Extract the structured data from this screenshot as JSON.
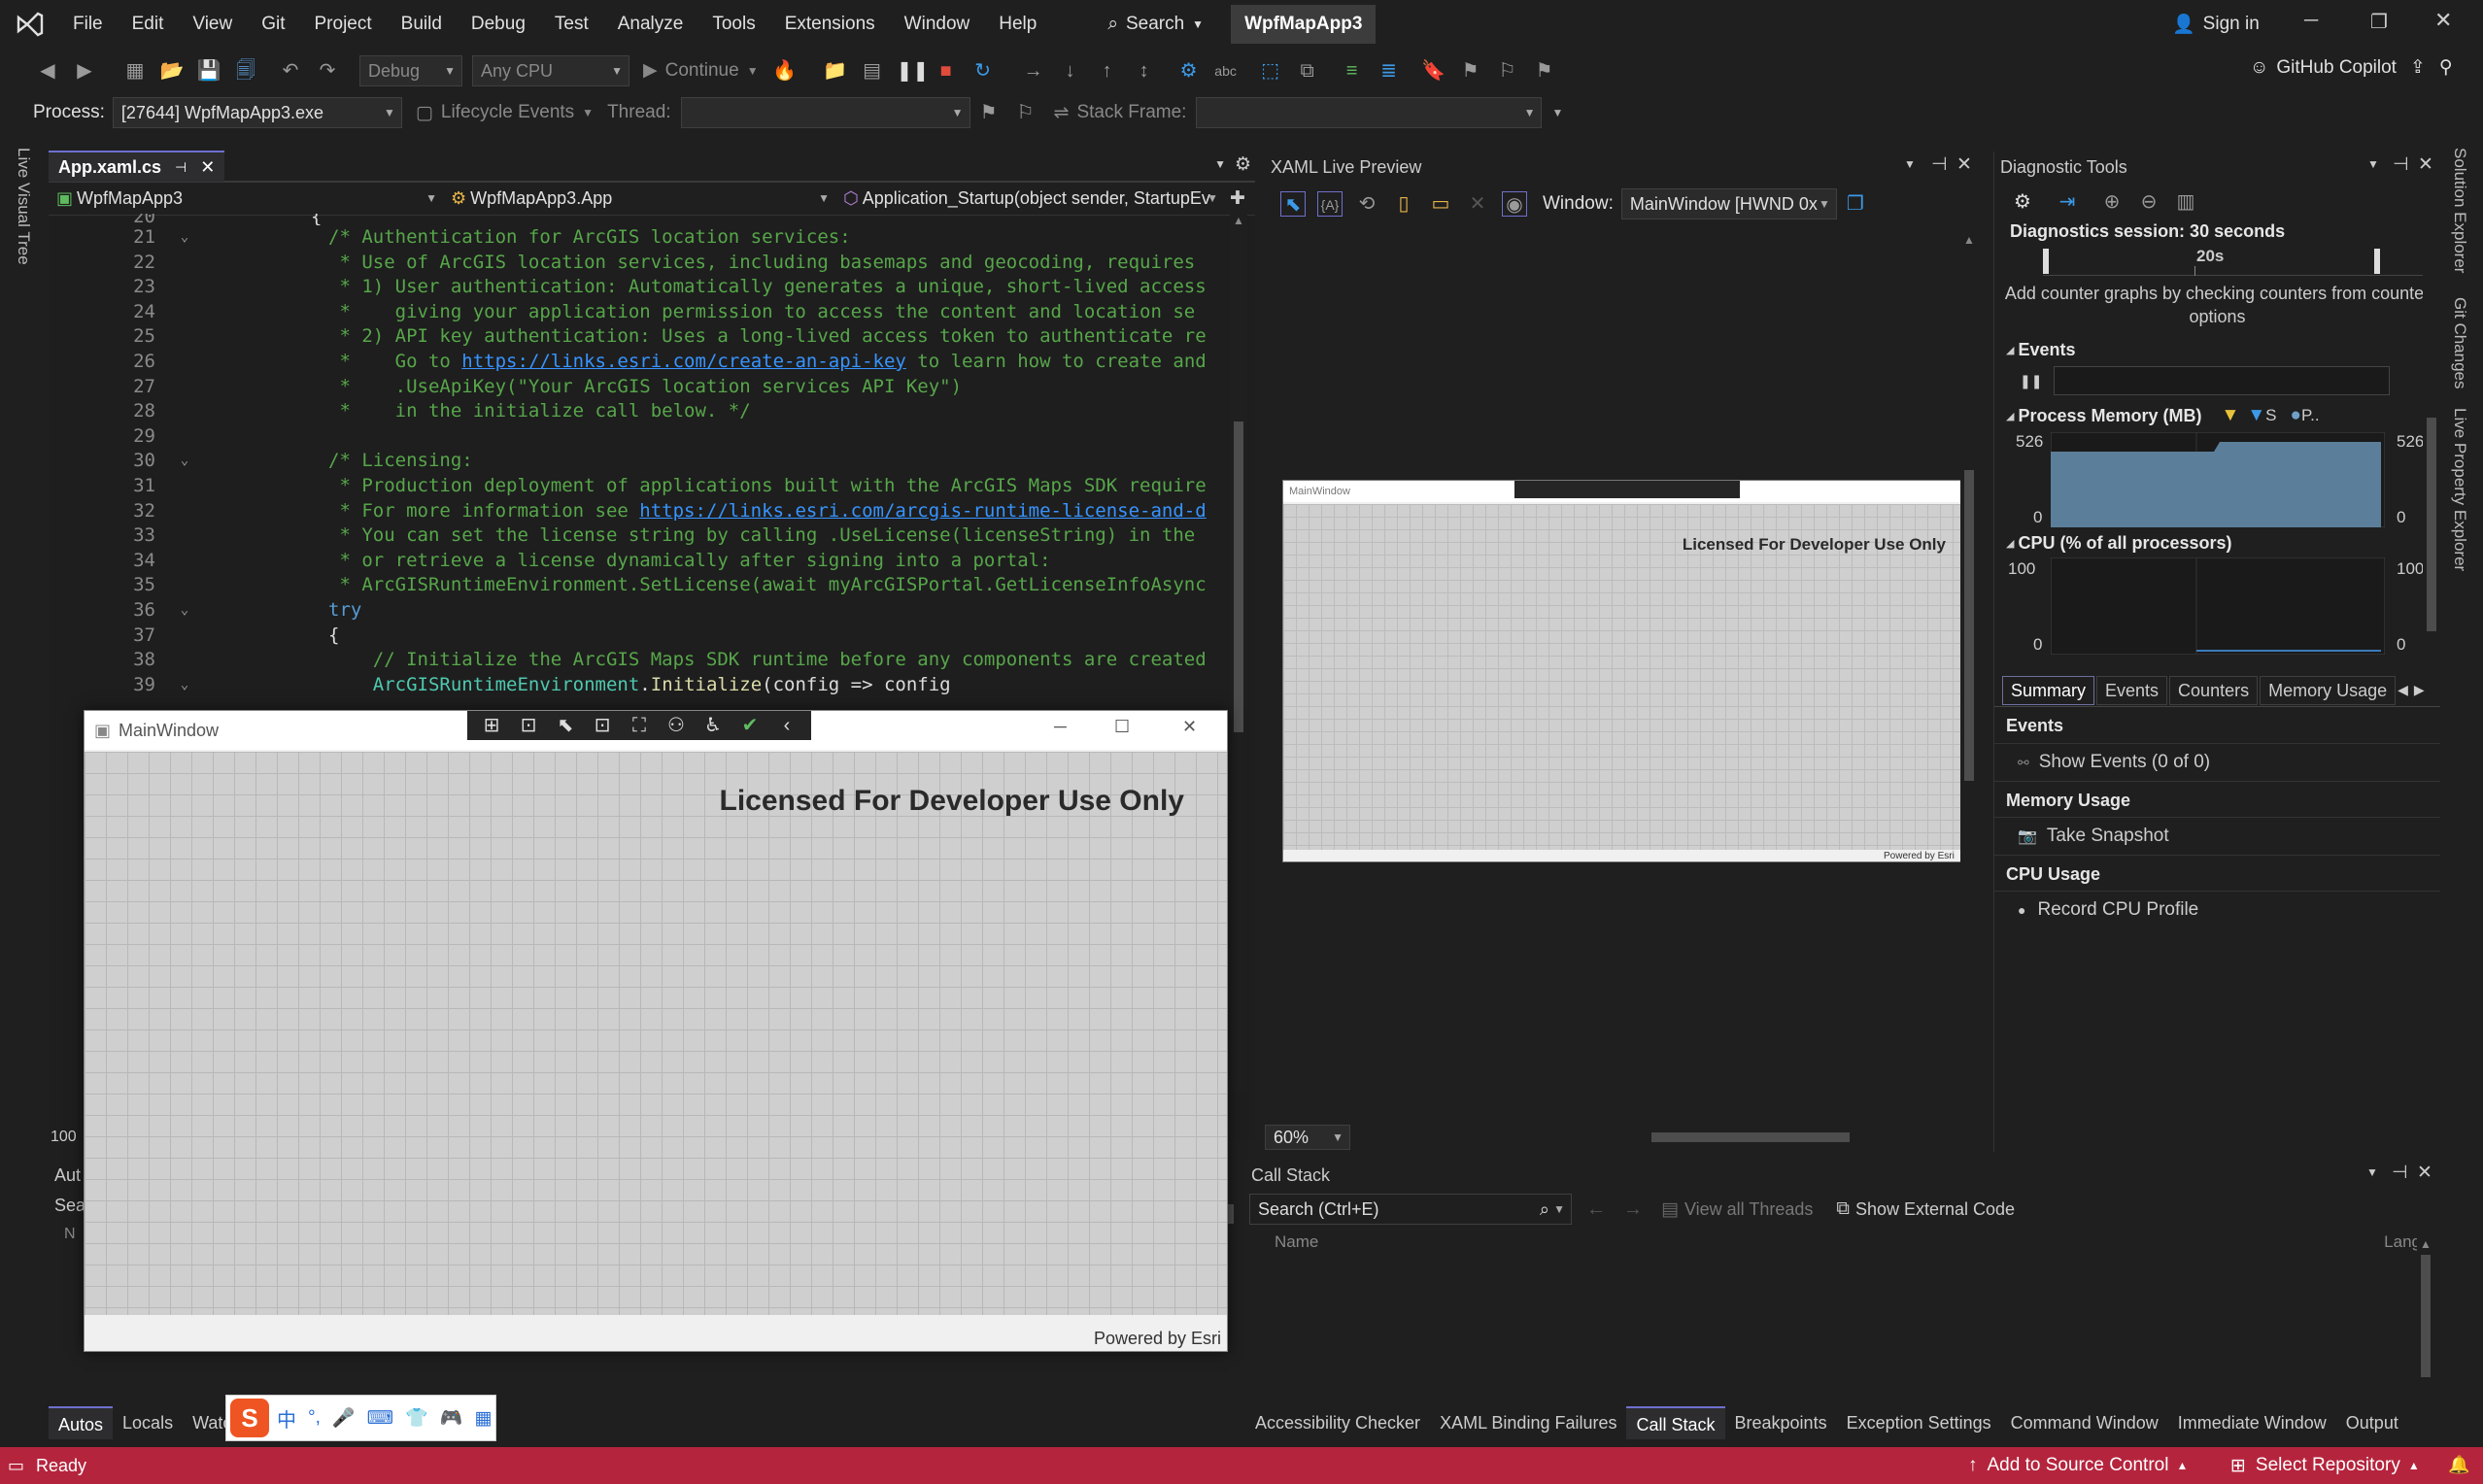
{
  "menubar": {
    "items": [
      "File",
      "Edit",
      "View",
      "Git",
      "Project",
      "Build",
      "Debug",
      "Test",
      "Analyze",
      "Tools",
      "Extensions",
      "Window",
      "Help"
    ],
    "search_label": "Search",
    "solution_name": "WpfMapApp3",
    "sign_in": "Sign in"
  },
  "toolbar": {
    "config": "Debug",
    "platform": "Any CPU",
    "continue_label": "Continue",
    "copilot_label": "GitHub Copilot"
  },
  "debugbar": {
    "process_label": "Process:",
    "process_value": "[27644] WpfMapApp3.exe",
    "lifecycle_label": "Lifecycle Events",
    "thread_label": "Thread:",
    "stackframe_label": "Stack Frame:"
  },
  "editor": {
    "tab_label": "App.xaml.cs",
    "nav_project": "WpfMapApp3",
    "nav_class": "WpfMapApp3.App",
    "nav_member": "Application_Startup(object sender, StartupEv",
    "zoom": "100",
    "line20": "20",
    "line20_text": "{",
    "lines": [
      {
        "n": "21",
        "segs": [
          {
            "c": "comment",
            "t": "/* Authentication for ArcGIS location services:"
          }
        ]
      },
      {
        "n": "22",
        "segs": [
          {
            "c": "comment",
            "t": " * Use of ArcGIS location services, including basemaps and geocoding, requires"
          }
        ]
      },
      {
        "n": "23",
        "segs": [
          {
            "c": "comment",
            "t": " * 1) User authentication: Automatically generates a unique, short-lived access"
          }
        ]
      },
      {
        "n": "24",
        "segs": [
          {
            "c": "comment",
            "t": " *    giving your application permission to access the content and location se"
          }
        ]
      },
      {
        "n": "25",
        "segs": [
          {
            "c": "comment",
            "t": " * 2) API key authentication: Uses a long-lived access token to authenticate re"
          }
        ]
      },
      {
        "n": "26",
        "segs": [
          {
            "c": "comment",
            "t": " *    Go to "
          },
          {
            "c": "link",
            "t": "https://links.esri.com/create-an-api-key"
          },
          {
            "c": "comment",
            "t": " to learn how to create and"
          }
        ]
      },
      {
        "n": "27",
        "segs": [
          {
            "c": "comment",
            "t": " *    .UseApiKey(\"Your ArcGIS location services API Key\")"
          }
        ]
      },
      {
        "n": "28",
        "segs": [
          {
            "c": "comment",
            "t": " *    in the initialize call below. */"
          }
        ]
      },
      {
        "n": "29",
        "segs": [
          {
            "c": "plain",
            "t": ""
          }
        ]
      },
      {
        "n": "30",
        "segs": [
          {
            "c": "comment",
            "t": "/* Licensing:"
          }
        ]
      },
      {
        "n": "31",
        "segs": [
          {
            "c": "comment",
            "t": " * Production deployment of applications built with the ArcGIS Maps SDK require"
          }
        ]
      },
      {
        "n": "32",
        "segs": [
          {
            "c": "comment",
            "t": " * For more information see "
          },
          {
            "c": "link",
            "t": "https://links.esri.com/arcgis-runtime-license-and-d"
          }
        ]
      },
      {
        "n": "33",
        "segs": [
          {
            "c": "comment",
            "t": " * You can set the license string by calling .UseLicense(licenseString) in the"
          }
        ]
      },
      {
        "n": "34",
        "segs": [
          {
            "c": "comment",
            "t": " * or retrieve a license dynamically after signing into a portal:"
          }
        ]
      },
      {
        "n": "35",
        "segs": [
          {
            "c": "comment",
            "t": " * ArcGISRuntimeEnvironment.SetLicense(await myArcGISPortal.GetLicenseInfoAsync"
          }
        ]
      },
      {
        "n": "36",
        "segs": [
          {
            "c": "kw",
            "t": "try"
          }
        ]
      },
      {
        "n": "37",
        "segs": [
          {
            "c": "plain",
            "t": "{"
          }
        ]
      },
      {
        "n": "38",
        "segs": [
          {
            "c": "comment",
            "t": "    // Initialize the ArcGIS Maps SDK runtime before any components are created"
          }
        ]
      },
      {
        "n": "39",
        "segs": [
          {
            "c": "cls",
            "t": "    ArcGISRuntimeEnvironment"
          },
          {
            "c": "plain",
            "t": "."
          },
          {
            "c": "method",
            "t": "Initialize"
          },
          {
            "c": "plain",
            "t": "(config => config"
          }
        ]
      }
    ]
  },
  "mainwindow": {
    "title": "MainWindow",
    "watermark": "Licensed For Developer Use Only",
    "attribution": "Powered by Esri"
  },
  "xaml_preview": {
    "title": "XAML Live Preview",
    "window_label": "Window:",
    "window_value": "MainWindow [HWND 0x",
    "zoom": "60%",
    "inner_title": "MainWindow",
    "inner_watermark": "Licensed For Developer Use Only",
    "inner_attribution": "Powered by Esri"
  },
  "diagnostics": {
    "title": "Diagnostic Tools",
    "session": "Diagnostics session: 30 seconds",
    "timeline_label": "20s",
    "hint": "Add counter graphs by checking counters from counter options",
    "events_label": "Events",
    "memory_label": "Process Memory (MB)",
    "memory_legend_s": "S",
    "memory_legend_p": "P..",
    "memory_max": "526",
    "memory_min": "0",
    "cpu_label": "CPU (% of all processors)",
    "cpu_max": "100",
    "cpu_min": "0",
    "tabs": [
      "Summary",
      "Events",
      "Counters",
      "Memory Usage"
    ],
    "sum_events": "Events",
    "show_events": "Show Events (0 of 0)",
    "sum_memory": "Memory Usage",
    "take_snapshot": "Take Snapshot",
    "sum_cpu": "CPU Usage",
    "record_cpu": "Record CPU Profile"
  },
  "callstack": {
    "title": "Call Stack",
    "search_placeholder": "Search (Ctrl+E)",
    "view_threads": "View all Threads",
    "show_external": "Show External Code",
    "col_name": "Name",
    "col_lang": "Lang"
  },
  "autos": {
    "title": "Aut",
    "search": "Sea",
    "col": "N"
  },
  "bottom_left_tabs": [
    "Autos",
    "Locals",
    "Watch"
  ],
  "bottom_right_tabs": [
    "Accessibility Checker",
    "XAML Binding Failures",
    "Call Stack",
    "Breakpoints",
    "Exception Settings",
    "Command Window",
    "Immediate Window",
    "Output"
  ],
  "side_tabs_left": [
    "Live Visual Tree"
  ],
  "side_tabs_right": [
    "Solution Explorer",
    "Git Changes",
    "Live Property Explorer"
  ],
  "ime": {
    "lang": "中"
  },
  "status": {
    "ready": "Ready",
    "add_source": "Add to Source Control",
    "select_repo": "Select Repository"
  },
  "colors": {
    "statusbar": "#b5243d",
    "accent": "#6f6fcf",
    "memory_fill": "#5b7f9a"
  }
}
